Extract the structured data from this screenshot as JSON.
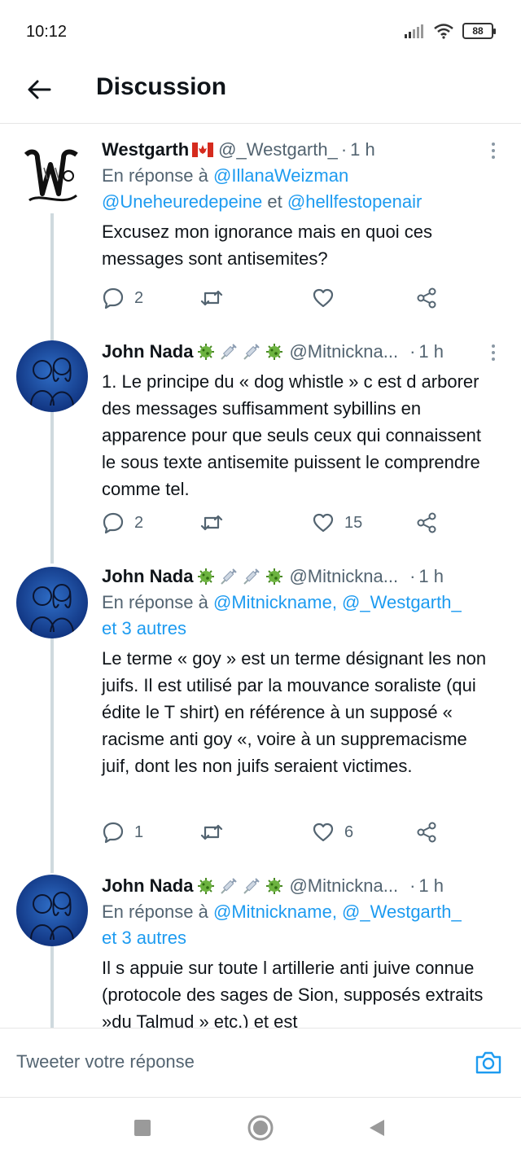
{
  "status": {
    "time": "10:12",
    "battery": "88"
  },
  "header": {
    "title": "Discussion"
  },
  "tweets": [
    {
      "name": "Westgarth",
      "handle": "@_Westgarth_",
      "time": "1 h",
      "reply_prefix": "En réponse à",
      "reply_mentions_1": "@IllanaWeizman",
      "reply_mentions_2": "@Uneheuredepeine",
      "reply_and": "et",
      "reply_mentions_3": "@hellfestopenair",
      "text": "Excusez mon ignorance mais en quoi ces messages sont antisemites?",
      "replies": "2",
      "retweets": "",
      "likes": ""
    },
    {
      "name": "John Nada",
      "handle": "@Mitnickna...",
      "time": "1 h",
      "text": "1. Le principe du « dog whistle » c est d arborer des messages suffisamment sybillins en apparence pour que seuls ceux qui connaissent le sous texte antisemite puissent le comprendre comme tel.",
      "replies": "2",
      "retweets": "",
      "likes": "15"
    },
    {
      "name": "John Nada",
      "handle": "@Mitnickna...",
      "time": "1 h",
      "reply_prefix": "En réponse à",
      "reply_mentions_1": "@Mitnickname, @_Westgarth_",
      "reply_mentions_2": "et 3 autres",
      "text": "Le terme « goy » est un terme désignant les non juifs. Il est utilisé par la mouvance soraliste (qui édite le T shirt) en référence à un supposé « racisme anti goy «, voire à un suppremacisme juif, dont les non juifs seraient victimes.",
      "replies": "1",
      "retweets": "",
      "likes": "6"
    },
    {
      "name": "John Nada",
      "handle": "@Mitnickna...",
      "time": "1 h",
      "reply_prefix": "En réponse à",
      "reply_mentions_1": "@Mitnickname, @_Westgarth_",
      "reply_mentions_2": "et 3 autres",
      "text": "Il s appuie sur toute l artillerie anti juive connue (protocole des sages de Sion, supposés extraits »du Talmud » etc.) et est"
    }
  ],
  "compose": {
    "placeholder": "Tweeter votre réponse"
  },
  "colors": {
    "accent": "#1d9bf0",
    "text": "#0f1419",
    "muted": "#536471",
    "thread_line": "#cfd9de"
  },
  "icons": [
    "back-arrow-icon",
    "reply-icon",
    "retweet-icon",
    "like-icon",
    "share-icon",
    "more-icon",
    "camera-icon",
    "virus-emoji-icon",
    "syringe-emoji-icon",
    "canada-flag-icon"
  ]
}
